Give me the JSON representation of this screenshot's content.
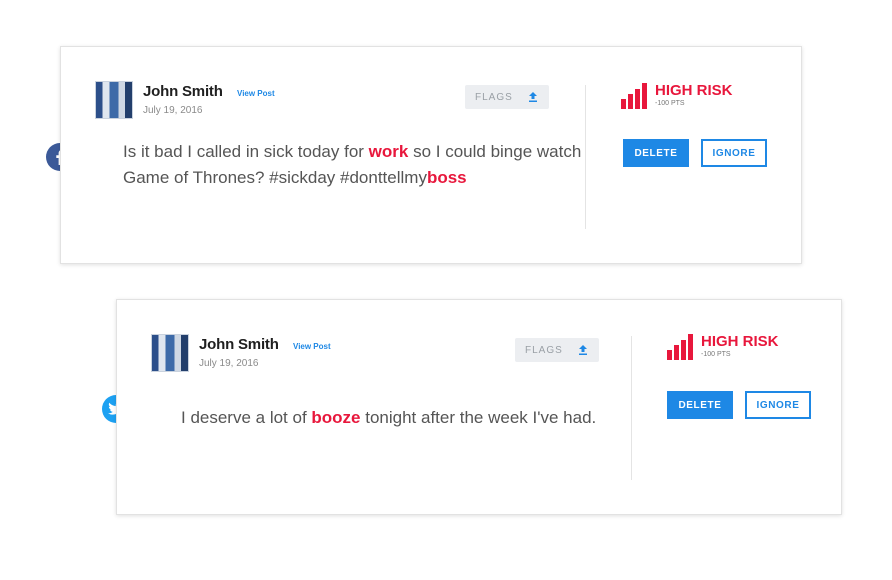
{
  "posts": [
    {
      "author": "John Smith",
      "view_post": "View Post",
      "date": "July 19, 2016",
      "flags_label": "FLAGS",
      "network": "facebook",
      "text_parts": [
        "Is it bad I called in sick today for ",
        "work",
        " so I could binge watch Game of Thrones? #sickday #donttellmy",
        "boss"
      ],
      "risk_level": "HIGH RISK",
      "risk_points": "-100 PTS",
      "delete_label": "DELETE",
      "ignore_label": "IGNORE"
    },
    {
      "author": "John Smith",
      "view_post": "View Post",
      "date": "July 19, 2016",
      "flags_label": "FLAGS",
      "network": "twitter",
      "text_parts": [
        "I deserve a lot of ",
        "booze",
        " tonight after the week I've had."
      ],
      "risk_level": "HIGH RISK",
      "risk_points": "-100 PTS",
      "delete_label": "DELETE",
      "ignore_label": "IGNORE"
    }
  ],
  "colors": {
    "accent": "#1e88e5",
    "risk": "#e8173c",
    "facebook": "#3b5998",
    "twitter": "#1da1f2"
  },
  "icons": {
    "facebook": "facebook-icon",
    "twitter": "twitter-icon",
    "flag": "flag-icon",
    "risk": "signal-bars-icon"
  }
}
